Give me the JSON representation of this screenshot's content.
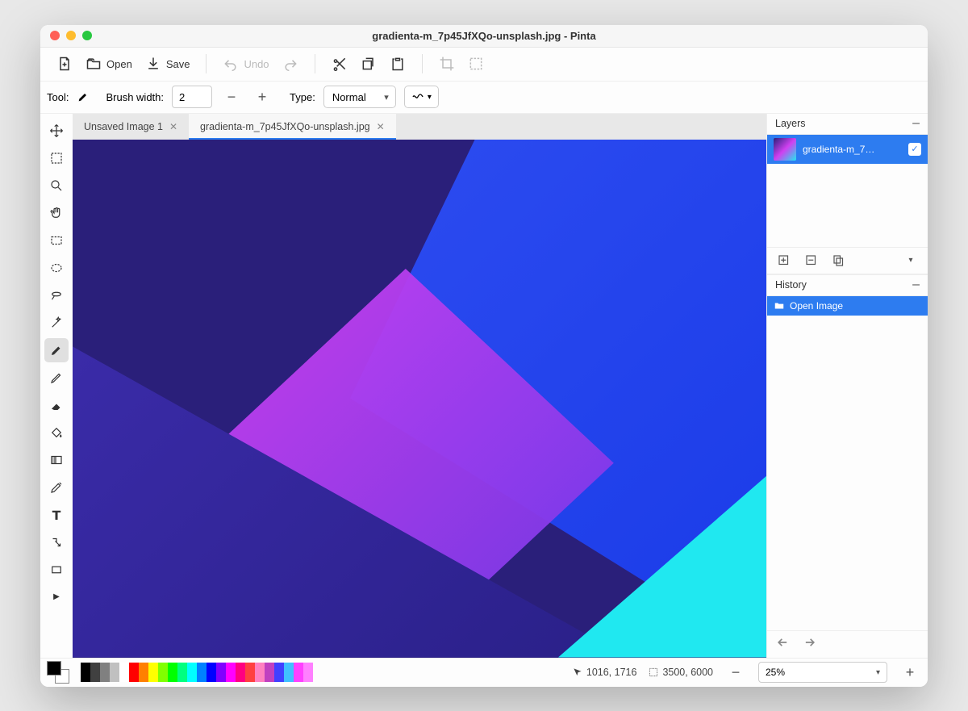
{
  "title": "gradienta-m_7p45JfXQo-unsplash.jpg - Pinta",
  "toolbar": {
    "open": "Open",
    "save": "Save",
    "undo": "Undo"
  },
  "tool_options": {
    "tool_label": "Tool:",
    "brush_width_label": "Brush width:",
    "brush_width": "2",
    "type_label": "Type:",
    "type_value": "Normal"
  },
  "tabs": [
    {
      "label": "Unsaved Image 1",
      "active": false
    },
    {
      "label": "gradienta-m_7p45JfXQo-unsplash.jpg",
      "active": true
    }
  ],
  "panels": {
    "layers_title": "Layers",
    "history_title": "History"
  },
  "layers": [
    {
      "name": "gradienta-m_7…",
      "visible": true
    }
  ],
  "history": [
    {
      "label": "Open Image"
    }
  ],
  "status": {
    "cursor": "1016, 1716",
    "dimensions": "3500, 6000",
    "zoom": "25%"
  },
  "palette": [
    "#000000",
    "#404040",
    "#808080",
    "#c0c0c0",
    "#ffffff",
    "#ff0000",
    "#ff8000",
    "#ffff00",
    "#80ff00",
    "#00ff00",
    "#00ff80",
    "#00ffff",
    "#0080ff",
    "#0000ff",
    "#8000ff",
    "#ff00ff",
    "#ff0080",
    "#ff4040",
    "#ff80c0",
    "#c040c0",
    "#4040ff",
    "#40c0ff",
    "#ff40ff",
    "#ff80ff"
  ]
}
